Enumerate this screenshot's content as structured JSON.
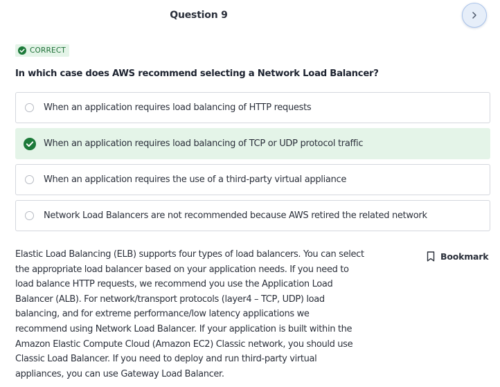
{
  "header": {
    "question_title": "Question 9",
    "next_icon": "chevron-right-icon"
  },
  "status": {
    "label": "CORRECT",
    "icon": "check-circle-icon",
    "color": "#1d7a3a",
    "background": "#e4f4e8"
  },
  "question": {
    "text": "In which case does AWS recommend selecting a Network Load Balancer?"
  },
  "options": [
    {
      "label": "When an application requires load balancing of HTTP requests",
      "selected": false
    },
    {
      "label": "When an application requires load balancing of TCP or UDP protocol traffic",
      "selected": true
    },
    {
      "label": "When an application requires the use of a third-party virtual appliance",
      "selected": false
    },
    {
      "label": "Network Load Balancers are not recommended because AWS retired the related network",
      "selected": false
    }
  ],
  "explanation": {
    "lines": [
      "Elastic Load Balancing (ELB) supports four types of load balancers. You can select",
      "the appropriate load balancer based on your application needs. If you need to",
      "load balance HTTP requests, we recommend you use the Application Load",
      "Balancer (ALB). For network/transport protocols (layer4 – TCP, UDP) load",
      "balancing, and for extreme performance/low latency applications we",
      "recommend using Network Load Balancer. If your application is built within the",
      "Amazon Elastic Compute Cloud (Amazon EC2) Classic network, you should use",
      "Classic Load Balancer. If you need to deploy and run third-party virtual",
      "appliances, you can use Gateway Load Balancer."
    ]
  },
  "bookmark": {
    "label": "Bookmark",
    "icon": "bookmark-icon"
  },
  "colors": {
    "correct_green": "#1d7a3a",
    "correct_bg": "#e4f4e8",
    "next_button_bg": "#e6eef9"
  }
}
